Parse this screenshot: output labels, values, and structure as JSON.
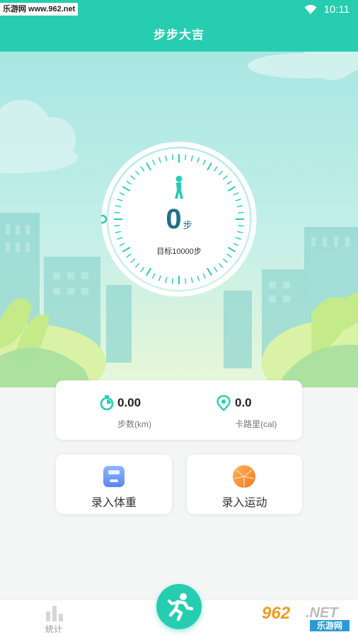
{
  "status_bar": {
    "watermark": "乐游网 www.962.net",
    "time": "10:11"
  },
  "header": {
    "title": "步步大吉"
  },
  "pedometer": {
    "steps_value": "0",
    "steps_unit": "步",
    "goal_text": "目标10000步",
    "icon": "walking-person-icon",
    "progress": 0
  },
  "stats": {
    "distance": {
      "value": "0.00",
      "label": "步数(km)",
      "icon": "stopwatch-icon"
    },
    "calories": {
      "value": "0.0",
      "label": "卡路里(cal)",
      "icon": "location-pin-icon"
    }
  },
  "actions": {
    "weight": {
      "label": "录入体重",
      "icon": "scale-icon"
    },
    "exercise": {
      "label": "录入运动",
      "icon": "basketball-icon"
    }
  },
  "tab_bar": {
    "stats_label": "统计",
    "stats_icon": "bar-chart-icon",
    "fab_icon": "running-person-icon"
  },
  "watermark_logo": {
    "number": "962",
    "suffix": ".NET",
    "name": "乐游网"
  },
  "colors": {
    "accent": "#27cdb1",
    "accent_dark": "#1f8a7a",
    "hero_top": "#a8e6e2"
  }
}
